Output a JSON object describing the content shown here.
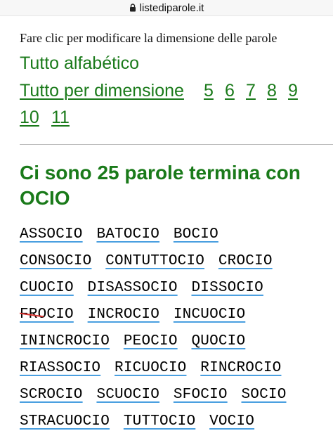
{
  "browser": {
    "url": "listediparole.it"
  },
  "instructions": "Fare clic per modificare la dimensione delle parole",
  "links": {
    "alphabetic": "Tutto alfabético",
    "by_size": "Tutto per dimensione",
    "sizes": [
      "5",
      "6",
      "7",
      "8",
      "9",
      "10",
      "11"
    ]
  },
  "heading": "Ci sono 25 parole termina con OCIO",
  "words": [
    "ASSOCIO",
    "BATOCIO",
    "BOCIO",
    "CONSOCIO",
    "CONTUTTOCIO",
    "CROCIO",
    "CUOCIO",
    "DISASSOCIO",
    "DISSOCIO",
    "FROCIO",
    "INCROCIO",
    "INCUOCIO",
    "ININCROCIO",
    "PEOCIO",
    "QUOCIO",
    "RIASSOCIO",
    "RICUOCIO",
    "RINCROCIO",
    "SCROCIO",
    "SCUOCIO",
    "SFOCIO",
    "SOCIO",
    "STRACUOCIO",
    "TUTTOCIO",
    "VOCIO"
  ],
  "colors": {
    "link": "#1a7a1a",
    "spell_underline": "#4a9fe0",
    "strike": "#d9322f"
  },
  "icons": {
    "lock": "lock-icon"
  }
}
